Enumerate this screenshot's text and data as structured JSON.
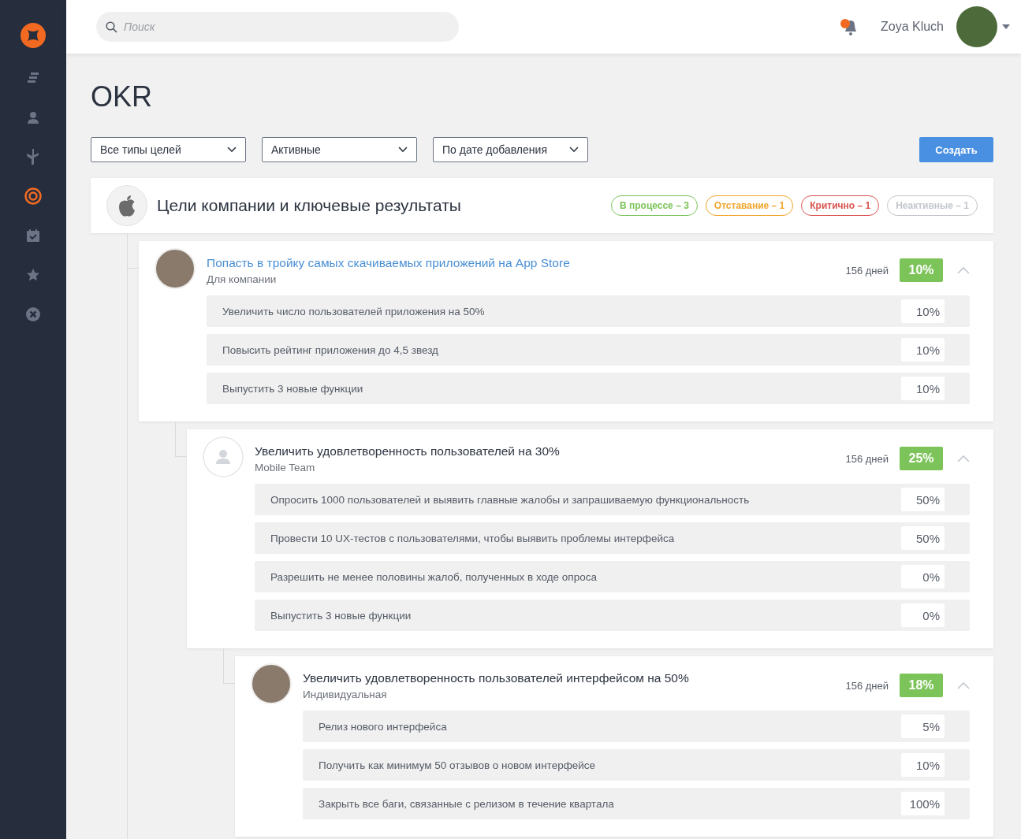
{
  "sidebar": {
    "items": [
      {
        "selected": false
      },
      {
        "selected": false
      },
      {
        "selected": false
      },
      {
        "selected": true
      },
      {
        "selected": false
      },
      {
        "selected": false
      },
      {
        "selected": false
      }
    ]
  },
  "header": {
    "search": {
      "placeholder": "Поиск"
    },
    "notifications": {
      "unread": true
    },
    "user": {
      "name": "Zoya Kluch"
    }
  },
  "page": {
    "title": "OKR"
  },
  "filters": [
    {
      "value": "Все типы целей"
    },
    {
      "value": "Активные"
    },
    {
      "value": "По дате добавления"
    }
  ],
  "create_button": "Создать",
  "company": {
    "title": "Цели компании и ключевые результаты",
    "statuses": [
      {
        "label": "В процессе – 3",
        "color": "#7cc35a"
      },
      {
        "label": "Отставание – 1",
        "color": "#f0a52a"
      },
      {
        "label": "Критично – 1",
        "color": "#d9534f"
      },
      {
        "label": "Неактивные – 1",
        "color": "#c2c6cc"
      }
    ],
    "objectives": [
      {
        "title": "Попасть в тройку самых скачиваемых приложений на App Store",
        "highlighted": true,
        "subtitle": "Для компании",
        "kind": "person",
        "days": "156 дней",
        "progress": "10%",
        "expanded": true,
        "key_results": [
          {
            "text": "Увеличить число пользователей приложения на 50%",
            "progress": "10%"
          },
          {
            "text": "Повысить рейтинг приложения до 4,5 звезд",
            "progress": "10%"
          },
          {
            "text": "Выпустить 3 новые функции",
            "progress": "10%"
          }
        ],
        "children": [
          {
            "title": "Увеличить удовлетворенность пользователей на 30%",
            "highlighted": false,
            "subtitle": "Mobile Team",
            "kind": "team",
            "days": "156 дней",
            "progress": "25%",
            "expanded": true,
            "key_results": [
              {
                "text": "Опросить 1000 пользователей и выявить главные жалобы и запрашиваемую функциональность",
                "progress": "50%"
              },
              {
                "text": "Провести 10 UX-тестов с пользователями, чтобы выявить проблемы интерфейса",
                "progress": "50%"
              },
              {
                "text": "Разрешить не менее половины жалоб, полученных в ходе опроса",
                "progress": "0%"
              },
              {
                "text": "Выпустить 3 новые функции",
                "progress": "0%"
              }
            ],
            "children": [
              {
                "title": "Увеличить удовлетворенность пользователей интерфейсом на 50%",
                "highlighted": false,
                "subtitle": "Индивидуальная",
                "kind": "person",
                "days": "156 дней",
                "progress": "18%",
                "expanded": true,
                "key_results": [
                  {
                    "text": "Релиз нового интерфейса",
                    "progress": "5%"
                  },
                  {
                    "text": "Получить как минимум 50 отзывов о новом интерфейсе",
                    "progress": "10%"
                  },
                  {
                    "text": "Закрыть все баги, связанные с релизом в течение квартала",
                    "progress": "100%"
                  }
                ]
              }
            ]
          }
        ]
      }
    ]
  }
}
